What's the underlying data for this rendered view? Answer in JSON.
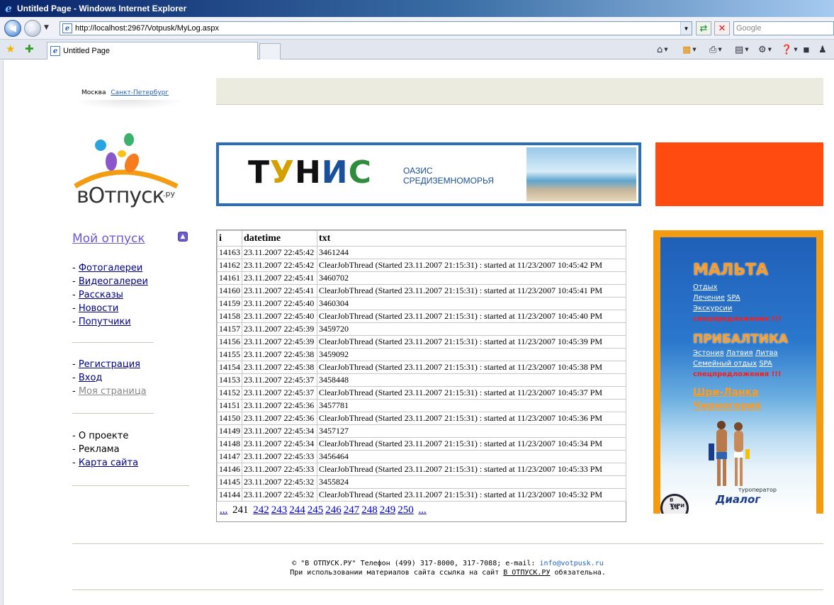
{
  "window": {
    "title": "Untitled Page - Windows Internet Explorer",
    "url": "http://localhost:2967/Votpusk/MyLog.aspx",
    "search_placeholder": "Google",
    "tab_title": "Untitled Page"
  },
  "page": {
    "cities": {
      "current": "Москва",
      "other": "Санкт-Петербург"
    },
    "logo": {
      "text": "вОтпуск",
      "suffix": ".ру"
    },
    "banner": {
      "title_letters": [
        "Т",
        "У",
        "Н",
        "И",
        "С"
      ],
      "subtitle_line1": "ОАЗИС",
      "subtitle_line2": "СРЕДИЗЕМНОМОРЬЯ"
    },
    "sidebar": {
      "title": "Мой отпуск",
      "group1": [
        "Фотогалереи",
        "Видеогалереи",
        "Рассказы",
        "Новости",
        "Попутчики"
      ],
      "group2": [
        "Регистрация",
        "Вход",
        "Моя страница"
      ],
      "group3_plain": [
        "О проекте",
        "Реклама"
      ],
      "group3_link": "Карта сайта"
    },
    "table": {
      "headers": [
        "i",
        "datetime",
        "txt"
      ],
      "rows": [
        [
          "14163",
          "23.11.2007 22:45:42",
          "3461244"
        ],
        [
          "14162",
          "23.11.2007 22:45:42",
          "ClearJobThread (Started 23.11.2007 21:15:31) : started at 11/23/2007 10:45:42 PM"
        ],
        [
          "14161",
          "23.11.2007 22:45:41",
          "3460702"
        ],
        [
          "14160",
          "23.11.2007 22:45:41",
          "ClearJobThread (Started 23.11.2007 21:15:31) : started at 11/23/2007 10:45:41 PM"
        ],
        [
          "14159",
          "23.11.2007 22:45:40",
          "3460304"
        ],
        [
          "14158",
          "23.11.2007 22:45:40",
          "ClearJobThread (Started 23.11.2007 21:15:31) : started at 11/23/2007 10:45:40 PM"
        ],
        [
          "14157",
          "23.11.2007 22:45:39",
          "3459720"
        ],
        [
          "14156",
          "23.11.2007 22:45:39",
          "ClearJobThread (Started 23.11.2007 21:15:31) : started at 11/23/2007 10:45:39 PM"
        ],
        [
          "14155",
          "23.11.2007 22:45:38",
          "3459092"
        ],
        [
          "14154",
          "23.11.2007 22:45:38",
          "ClearJobThread (Started 23.11.2007 21:15:31) : started at 11/23/2007 10:45:38 PM"
        ],
        [
          "14153",
          "23.11.2007 22:45:37",
          "3458448"
        ],
        [
          "14152",
          "23.11.2007 22:45:37",
          "ClearJobThread (Started 23.11.2007 21:15:31) : started at 11/23/2007 10:45:37 PM"
        ],
        [
          "14151",
          "23.11.2007 22:45:36",
          "3457781"
        ],
        [
          "14150",
          "23.11.2007 22:45:36",
          "ClearJobThread (Started 23.11.2007 21:15:31) : started at 11/23/2007 10:45:36 PM"
        ],
        [
          "14149",
          "23.11.2007 22:45:34",
          "3457127"
        ],
        [
          "14148",
          "23.11.2007 22:45:34",
          "ClearJobThread (Started 23.11.2007 21:15:31) : started at 11/23/2007 10:45:34 PM"
        ],
        [
          "14147",
          "23.11.2007 22:45:33",
          "3456464"
        ],
        [
          "14146",
          "23.11.2007 22:45:33",
          "ClearJobThread (Started 23.11.2007 21:15:31) : started at 11/23/2007 10:45:33 PM"
        ],
        [
          "14145",
          "23.11.2007 22:45:32",
          "3455824"
        ],
        [
          "14144",
          "23.11.2007 22:45:32",
          "ClearJobThread (Started 23.11.2007 21:15:31) : started at 11/23/2007 10:45:32 PM"
        ]
      ],
      "pager": {
        "prev": "...",
        "current": "241",
        "pages": [
          "242",
          "243",
          "244",
          "245",
          "246",
          "247",
          "248",
          "249",
          "250"
        ],
        "next": "..."
      }
    },
    "ad": {
      "malta": "МАЛЬТА",
      "malta_links": [
        "Отдых",
        "Лечение",
        "SPA",
        "Экскурсии"
      ],
      "malta_special": "спецпредложения !!!",
      "baltic": "ПРИБАЛТИКА",
      "baltic_links_1": [
        "Эстония",
        "Латвия",
        "Литва"
      ],
      "baltic_links_2": [
        "Семейный отдых",
        "SPA"
      ],
      "baltic_special": "спецпредложения !!!",
      "extra": [
        "Шри-Ланка",
        "Черногория"
      ],
      "operator_label": "туроператор",
      "operator_name": "Диалог",
      "stamp_number": "14",
      "stamp_text": "В ТУРИ"
    },
    "footer": {
      "line1_text": "© \"В ОТПУСК.РУ\" Телефон (499) 317-8000, 317-7088; e-mail: ",
      "email": "info@votpusk.ru",
      "line2_pre": "При использовании материалов сайта ссылка на сайт ",
      "line2_link": "В ОТПУСК.РУ",
      "line2_post": " обязательна."
    }
  },
  "colors": {
    "link": "#000080",
    "accent_orange": "#ff4a10",
    "ad_border": "#f39c12",
    "sidebar_title": "#6a5acd"
  }
}
